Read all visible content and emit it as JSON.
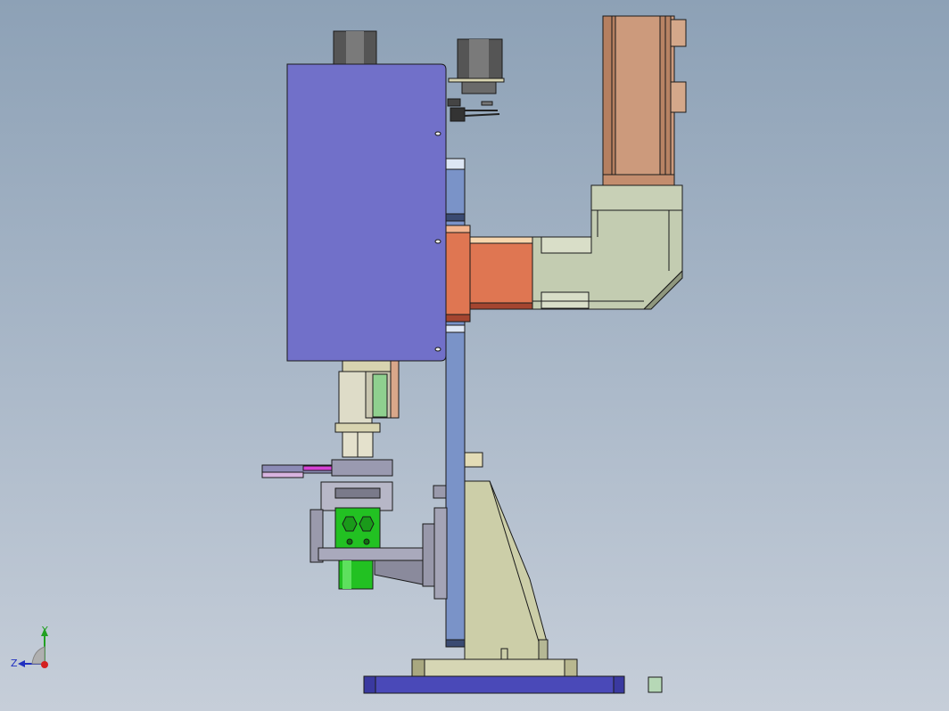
{
  "viewport": {
    "background_top": "#8da1b6",
    "background_bottom": "#c6ced9"
  },
  "colors": {
    "housing_blue": "#7170c9",
    "column_blue": "#7a93c8",
    "motor_brown": "#cc9a7c",
    "arm_orange": "#df7652",
    "arm_sage": "#c3ccb1",
    "bracket_tan": "#cccea8",
    "base_navy": "#4a49b8",
    "cylinder_gray": "#5a5a5a",
    "collet_green": "#22c122",
    "accent_magenta": "#d542d5",
    "outline": "#1a1a1a"
  },
  "axis_triad": {
    "y_label": "Y",
    "z_label": "Z",
    "x_color": "#d42020",
    "y_color": "#22a022",
    "z_color": "#2030c0"
  }
}
